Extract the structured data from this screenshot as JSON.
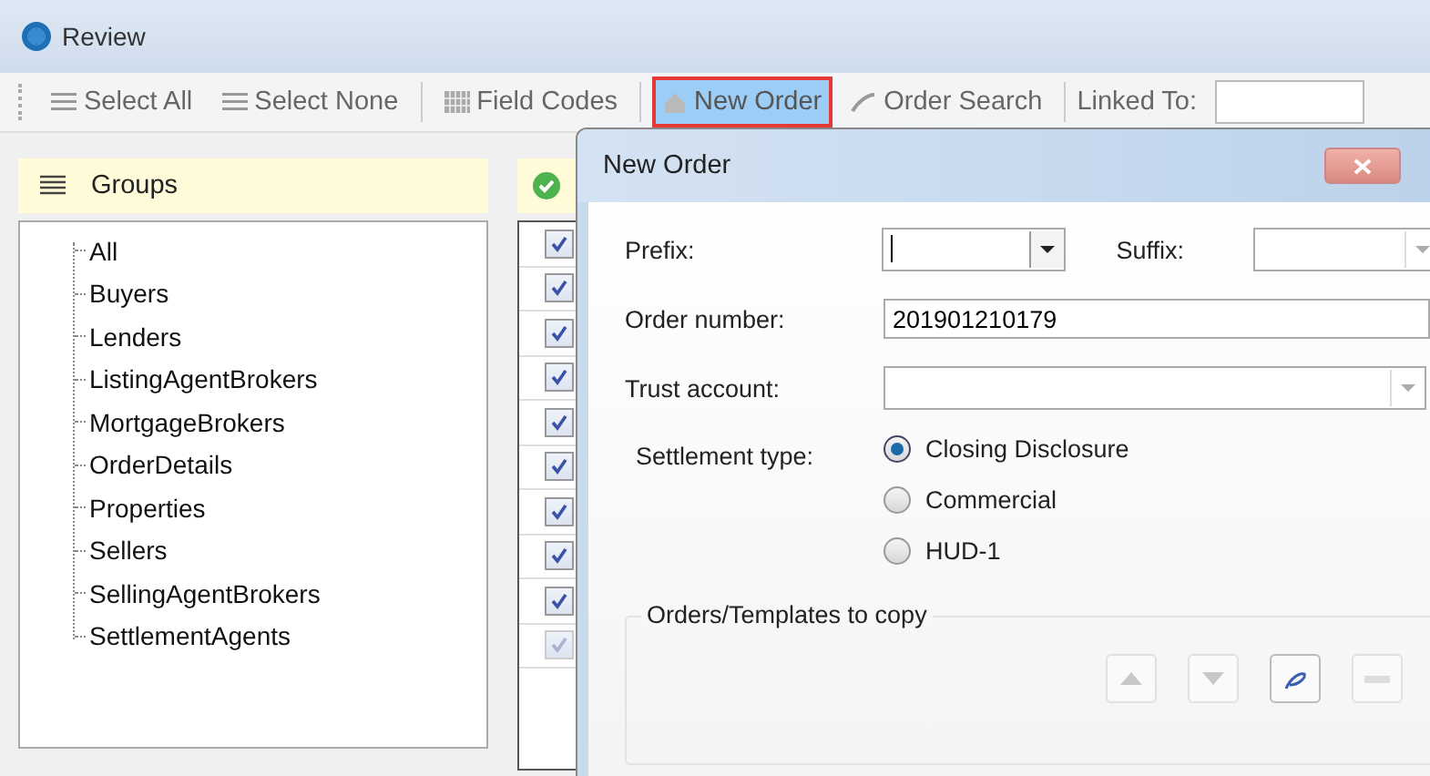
{
  "window": {
    "title": "Review"
  },
  "toolbar": [
    {
      "kind": "select-all",
      "label": "Select All",
      "highlighted": false
    },
    {
      "kind": "select-none",
      "label": "Select None",
      "highlighted": false
    },
    {
      "kind": "field-codes",
      "label": "Field Codes",
      "highlighted": false
    },
    {
      "kind": "new-order",
      "label": "New Order",
      "highlighted": true
    },
    {
      "kind": "order-search",
      "label": "Order Search",
      "highlighted": false
    }
  ],
  "linked_to": {
    "label": "Linked To:"
  },
  "groups": {
    "title": "Groups",
    "items": [
      "All",
      "Buyers",
      "Lenders",
      "ListingAgentBrokers",
      "MortgageBrokers",
      "OrderDetails",
      "Properties",
      "Sellers",
      "SellingAgentBrokers",
      "SettlementAgents"
    ]
  },
  "grid": {
    "rows": [
      {
        "checked": true,
        "disabled": false
      },
      {
        "checked": true,
        "disabled": false
      },
      {
        "checked": true,
        "disabled": false
      },
      {
        "checked": true,
        "disabled": false
      },
      {
        "checked": true,
        "disabled": false
      },
      {
        "checked": true,
        "disabled": false
      },
      {
        "checked": true,
        "disabled": false
      },
      {
        "checked": true,
        "disabled": false
      },
      {
        "checked": true,
        "disabled": false
      },
      {
        "checked": true,
        "disabled": true
      }
    ]
  },
  "dialog": {
    "title": "New Order",
    "prefix": {
      "label": "Prefix:"
    },
    "suffix": {
      "label": "Suffix:"
    },
    "order_number": {
      "label": "Order number:",
      "value": "201901210179"
    },
    "trust_account": {
      "label": "Trust account:"
    },
    "settlement_type": {
      "label": "Settlement type:",
      "options": [
        {
          "label": "Closing Disclosure",
          "selected": true
        },
        {
          "label": "Commercial",
          "selected": false
        },
        {
          "label": "HUD-1",
          "selected": false
        }
      ]
    },
    "copy_group": {
      "title": "Orders/Templates to copy",
      "buttons": [
        {
          "kind": "up",
          "disabled": true
        },
        {
          "kind": "down",
          "disabled": true
        },
        {
          "kind": "edit",
          "disabled": false
        },
        {
          "kind": "remove",
          "disabled": true
        }
      ]
    }
  }
}
